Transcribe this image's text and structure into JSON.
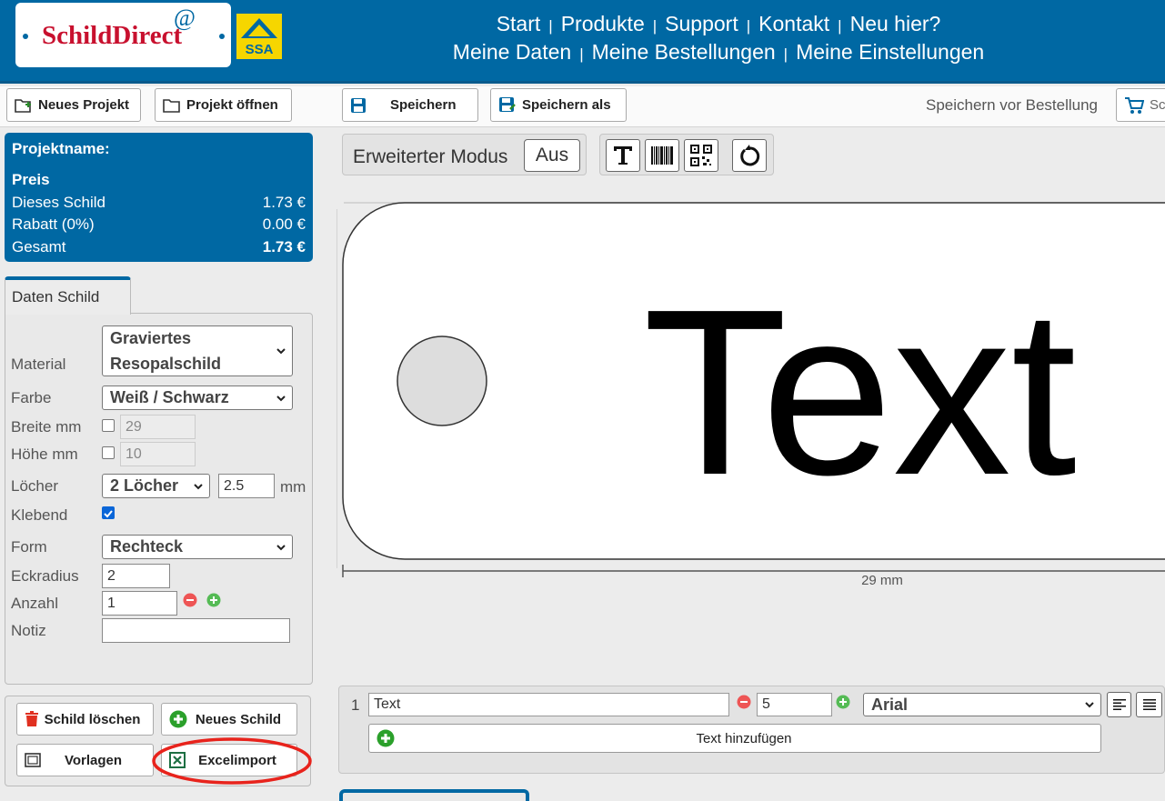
{
  "header": {
    "logo_text": "SchildDirect",
    "logo_at": "@",
    "badge_text": "SSA",
    "nav_row1": [
      "Start",
      "Produkte",
      "Support",
      "Kontakt",
      "Neu hier?"
    ],
    "nav_row2": [
      "Meine Daten",
      "Meine Bestellungen",
      "Meine Einstellungen"
    ],
    "separator": "|"
  },
  "toolbar": {
    "new_project": "Neues Projekt",
    "open_project": "Projekt öffnen",
    "save": "Speichern",
    "save_as": "Speichern als",
    "save_hint": "Speichern vor Bestellung",
    "cart_partial": "Sch"
  },
  "price": {
    "project_label": "Projektname:",
    "heading": "Preis",
    "rows": [
      {
        "label": "Dieses Schild",
        "value": "1.73 €"
      },
      {
        "label": "Rabatt (0%)",
        "value": "0.00 €"
      },
      {
        "label": "Gesamt",
        "value": "1.73 €"
      }
    ]
  },
  "form": {
    "tab": "Daten Schild",
    "material_label": "Material",
    "material_value_line1": "Graviertes",
    "material_value_line2": "Resopalschild",
    "color_label": "Farbe",
    "color_value": "Weiß / Schwarz",
    "width_label": "Breite mm",
    "width_value": "29",
    "height_label": "Höhe mm",
    "height_value": "10",
    "holes_label": "Löcher",
    "holes_value": "2 Löcher",
    "hole_size": "2.5",
    "hole_unit": "mm",
    "adhesive_label": "Klebend",
    "adhesive_checked": true,
    "shape_label": "Form",
    "shape_value": "Rechteck",
    "radius_label": "Eckradius",
    "radius_value": "2",
    "count_label": "Anzahl",
    "count_value": "1",
    "note_label": "Notiz",
    "note_value": ""
  },
  "actions": {
    "delete": "Schild löschen",
    "new_sign": "Neues Schild",
    "templates": "Vorlagen",
    "excel": "Excelimport",
    "highlight_color": "#e8231c"
  },
  "editor": {
    "mode_label": "Erweiterter Modus",
    "mode_value": "Aus",
    "tools": [
      "text-tool-icon",
      "barcode-icon",
      "qrcode-icon",
      "rotate-icon"
    ],
    "sign_text": "Text",
    "dimension_label": "29 mm"
  },
  "textlines": {
    "rows": [
      {
        "index": "1",
        "text": "Text",
        "size": "5",
        "font": "Arial"
      }
    ],
    "add_label": "Text hinzufügen"
  },
  "colors": {
    "brand_blue": "#0068a3",
    "brand_red": "#c8102e",
    "badge_yellow": "#f6d600"
  }
}
